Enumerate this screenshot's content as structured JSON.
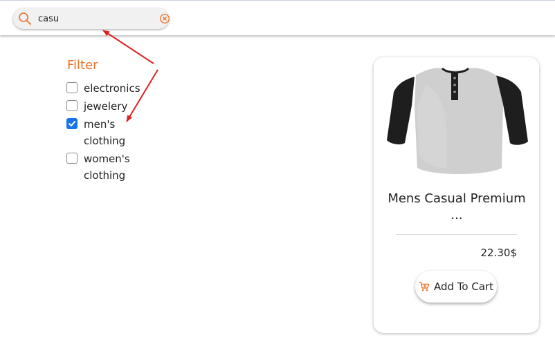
{
  "search": {
    "value": "casu",
    "placeholder": ""
  },
  "filter": {
    "title": "Filter",
    "options": [
      {
        "label": "electronics",
        "checked": false
      },
      {
        "label": "jewelery",
        "checked": false
      },
      {
        "label": "men's clothing",
        "checked": true
      },
      {
        "label": "women's clothing",
        "checked": false
      }
    ]
  },
  "product": {
    "title": "Mens Casual Premium ...",
    "price": "22.30$",
    "add_to_cart_label": "Add To Cart"
  },
  "colors": {
    "accent": "#e8722a",
    "checkbox": "#1a73e8",
    "arrow": "#e02020"
  },
  "icons": {
    "search": "search-icon",
    "clear": "clear-circle-x-icon",
    "cart": "cart-plus-icon",
    "check": "checkmark-icon"
  }
}
